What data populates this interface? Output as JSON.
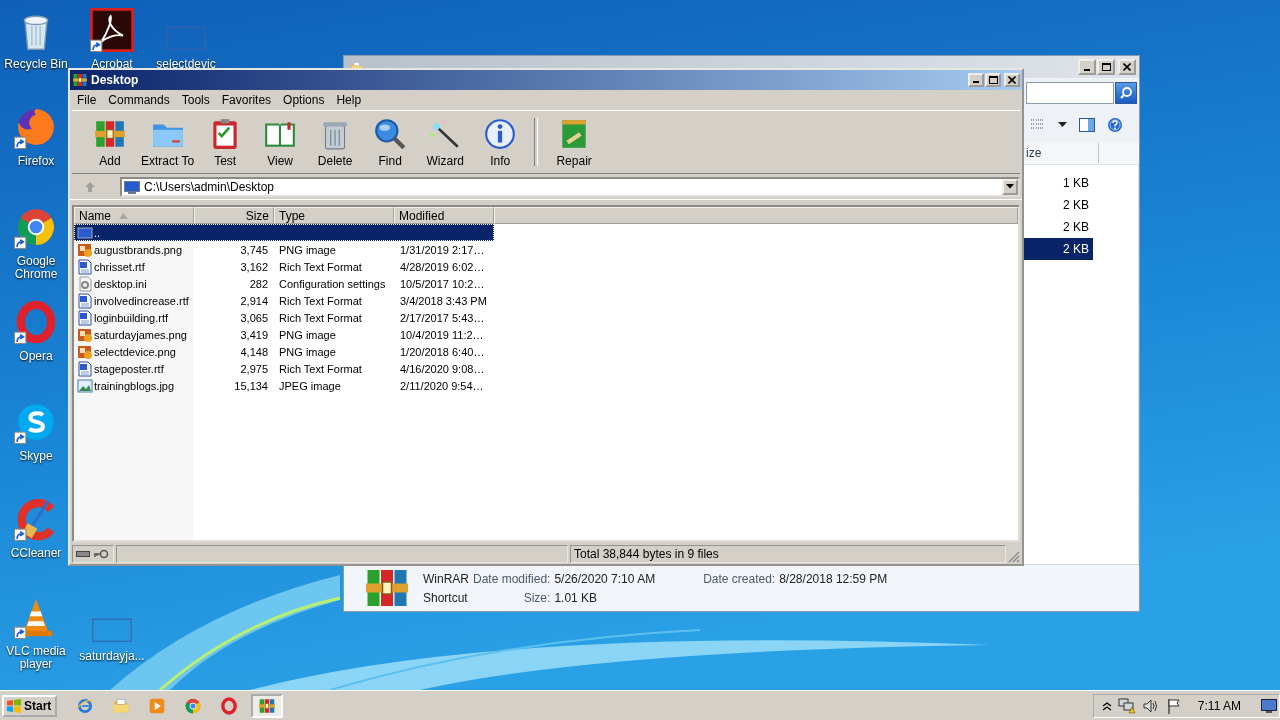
{
  "desktop": {
    "icons": [
      {
        "label": "Recycle Bin",
        "kind": "recycle",
        "shortcut": false
      },
      {
        "label": "Acrobat",
        "kind": "acrobat",
        "shortcut": true
      },
      {
        "label": "selectdevic",
        "kind": "thumbnail",
        "shortcut": false
      },
      {
        "label": "Firefox",
        "kind": "firefox",
        "shortcut": true
      },
      {
        "label": "Google Chrome",
        "kind": "chrome",
        "shortcut": true
      },
      {
        "label": "Opera",
        "kind": "opera",
        "shortcut": true
      },
      {
        "label": "Skype",
        "kind": "skype",
        "shortcut": true
      },
      {
        "label": "CCleaner",
        "kind": "ccleaner",
        "shortcut": true
      },
      {
        "label": "VLC media player",
        "kind": "vlc",
        "shortcut": true
      },
      {
        "label": "saturdayja...",
        "kind": "thumbnail",
        "shortcut": false
      }
    ]
  },
  "explorer": {
    "column": "ize",
    "rows": [
      {
        "size": "1 KB",
        "selected": false
      },
      {
        "size": "2 KB",
        "selected": false
      },
      {
        "size": "2 KB",
        "selected": false
      },
      {
        "size": "2 KB",
        "selected": true
      }
    ],
    "details": {
      "name": "WinRAR",
      "type": "Shortcut",
      "fields": [
        {
          "label": "Date modified:",
          "value": "5/26/2020 7:10 AM"
        },
        {
          "label": "Date created:",
          "value": "8/28/2018 12:59 PM"
        },
        {
          "label": "Size:",
          "value": "1.01 KB"
        }
      ]
    }
  },
  "winrar": {
    "title": "Desktop",
    "menu": [
      "File",
      "Commands",
      "Tools",
      "Favorites",
      "Options",
      "Help"
    ],
    "toolbar": [
      {
        "label": "Add",
        "kind": "add"
      },
      {
        "label": "Extract To",
        "kind": "extract"
      },
      {
        "label": "Test",
        "kind": "test"
      },
      {
        "label": "View",
        "kind": "view"
      },
      {
        "label": "Delete",
        "kind": "delete"
      },
      {
        "label": "Find",
        "kind": "find"
      },
      {
        "label": "Wizard",
        "kind": "wizard"
      },
      {
        "label": "Info",
        "kind": "info"
      },
      {
        "kind": "separator"
      },
      {
        "label": "Repair",
        "kind": "repair"
      }
    ],
    "up_button": {
      "disabled": true
    },
    "path": "C:\\Users\\admin\\Desktop",
    "columns": [
      {
        "label": "Name",
        "sort_ascending": true
      },
      {
        "label": "Size"
      },
      {
        "label": "Type"
      },
      {
        "label": "Modified"
      }
    ],
    "rows": [
      {
        "name": "..",
        "kind": "up",
        "selected": true
      },
      {
        "name": "augustbrands.png",
        "kind": "png",
        "size": "3,745",
        "type": "PNG image",
        "modified": "1/31/2019 2:17…",
        "selected": false
      },
      {
        "name": "chrisset.rtf",
        "kind": "rtf",
        "size": "3,162",
        "type": "Rich Text Format",
        "modified": "4/28/2019 6:02…",
        "selected": false
      },
      {
        "name": "desktop.ini",
        "kind": "ini",
        "size": "282",
        "type": "Configuration settings",
        "modified": "10/5/2017 10:2…",
        "selected": false
      },
      {
        "name": "involvedincrease.rtf",
        "kind": "rtf",
        "size": "2,914",
        "type": "Rich Text Format",
        "modified": "3/4/2018 3:43 PM",
        "selected": false
      },
      {
        "name": "loginbuilding.rtf",
        "kind": "rtf",
        "size": "3,065",
        "type": "Rich Text Format",
        "modified": "2/17/2017 5:43…",
        "selected": false
      },
      {
        "name": "saturdayjames.png",
        "kind": "png",
        "size": "3,419",
        "type": "PNG image",
        "modified": "10/4/2019 11:2…",
        "selected": false
      },
      {
        "name": "selectdevice.png",
        "kind": "png",
        "size": "4,148",
        "type": "PNG image",
        "modified": "1/20/2018 6:40…",
        "selected": false
      },
      {
        "name": "stageposter.rtf",
        "kind": "rtf",
        "size": "2,975",
        "type": "Rich Text Format",
        "modified": "4/16/2020 9:08…",
        "selected": false
      },
      {
        "name": "trainingblogs.jpg",
        "kind": "jpg",
        "size": "15,134",
        "type": "JPEG image",
        "modified": "2/11/2020 9:54…",
        "selected": false
      }
    ],
    "status": "Total 38,844 bytes in 9 files"
  },
  "taskbar": {
    "start": "Start",
    "apps": [
      {
        "kind": "ie",
        "active": false
      },
      {
        "kind": "explorer",
        "active": false
      },
      {
        "kind": "media",
        "active": false
      },
      {
        "kind": "chrome",
        "active": false
      },
      {
        "kind": "opera",
        "active": false
      },
      {
        "kind": "winrar",
        "active": true
      }
    ],
    "clock": "7:11 AM"
  }
}
